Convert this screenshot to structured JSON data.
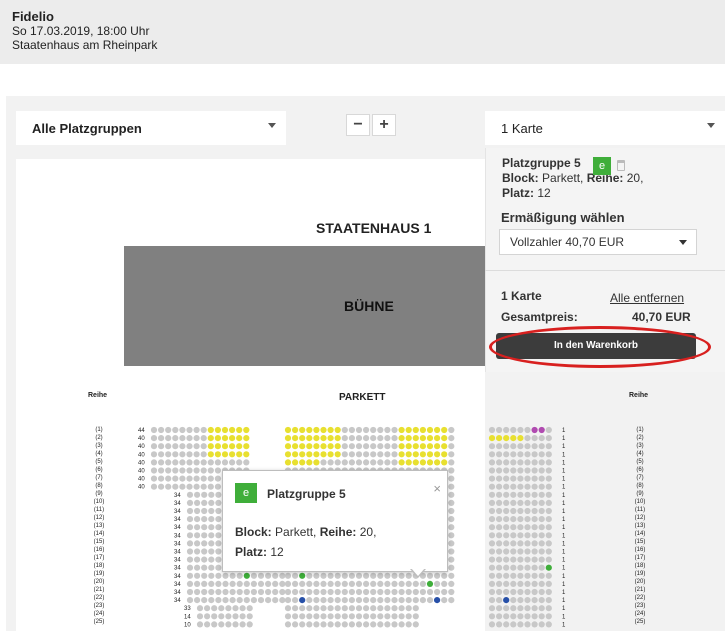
{
  "event": {
    "title": "Fidelio",
    "date": "So 17.03.2019, 18:00 Uhr",
    "venue": "Staatenhaus am Rheinpark"
  },
  "filters": {
    "group_select": "Alle Platzgruppen",
    "zoom_out": "−",
    "zoom_in": "+",
    "qty_select": "1 Karte"
  },
  "selection": {
    "group": "Platzgruppe 5",
    "block_label": "Block:",
    "block_value": " Parkett, ",
    "row_label": "Reihe:",
    "row_value": " 20,",
    "seat_label": "Platz:",
    "seat_value": " 12",
    "badge": "e",
    "discount_label": "Ermäßigung wählen",
    "discount_value": "Vollzahler 40,70 EUR",
    "count": "1 Karte",
    "remove_all": "Alle entfernen",
    "total_label": "Gesamtpreis:",
    "total_value": "40,70 EUR",
    "cart_button": "In den Warenkorb"
  },
  "map": {
    "hall": "STAATENHAUS 1",
    "stage": "BÜHNE",
    "section": "PARKETT",
    "row_header": "Reihe",
    "rows": [
      "(1)",
      "(2)",
      "(3)",
      "(4)",
      "(5)",
      "(6)",
      "(7)",
      "(8)",
      "(9)",
      "(10)",
      "(11)",
      "(12)",
      "(13)",
      "(14)",
      "(15)",
      "(16)",
      "(17)",
      "(18)",
      "(19)",
      "(20)",
      "(21)",
      "(22)",
      "(23)",
      "(24)",
      "(25)"
    ],
    "left_seat_numbers": [
      "44",
      "40",
      "40",
      "40",
      "40",
      "40",
      "40",
      "40",
      "34",
      "34",
      "34",
      "34",
      "34",
      "34",
      "34",
      "34",
      "34",
      "34",
      "34",
      "34",
      "34",
      "34",
      "33",
      "14",
      "10"
    ],
    "right_seat_numbers": [
      "1",
      "1",
      "1",
      "1",
      "1",
      "1",
      "1",
      "1",
      "1",
      "1",
      "1",
      "1",
      "1",
      "1",
      "1",
      "1",
      "1",
      "1",
      "1",
      "1",
      "1",
      "1",
      "1",
      "1",
      "1"
    ],
    "colors": {
      "available": "#c8c8c8",
      "yellow": "#e8e030",
      "purple": "#b04ab0",
      "green": "#3fae3a",
      "blue": "#2750a8"
    }
  },
  "tooltip": {
    "badge": "e",
    "title": "Platzgruppe 5",
    "block_label": "Block:",
    "block_value": " Parkett, ",
    "row_label": "Reihe:",
    "row_value": " 20,",
    "seat_label": "Platz:",
    "seat_value": " 12",
    "close": "×"
  }
}
